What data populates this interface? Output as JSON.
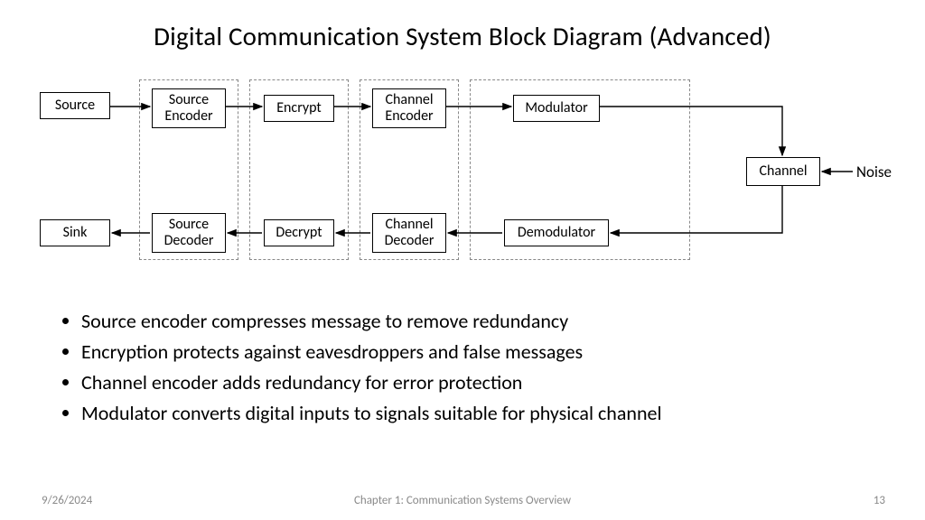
{
  "title": "Digital Communication System Block Diagram (Advanced)",
  "blocks": {
    "source": "Source",
    "sourceEncoder": "Source\nEncoder",
    "encrypt": "Encrypt",
    "chanEncoder": "Channel\nEncoder",
    "modulator": "Modulator",
    "channel": "Channel",
    "demodulator": "Demodulator",
    "chanDecoder": "Channel\nDecoder",
    "decrypt": "Decrypt",
    "sourceDecoder": "Source\nDecoder",
    "sink": "Sink"
  },
  "noise": "Noise",
  "bullets": [
    "Source encoder compresses message to remove redundancy",
    "Encryption protects against eavesdroppers and false messages",
    "Channel encoder adds redundancy for error protection",
    "Modulator converts digital inputs to signals suitable for physical channel"
  ],
  "footer": {
    "date": "9/26/2024",
    "chapter": "Chapter 1: Communication Systems Overview",
    "page": "13"
  }
}
